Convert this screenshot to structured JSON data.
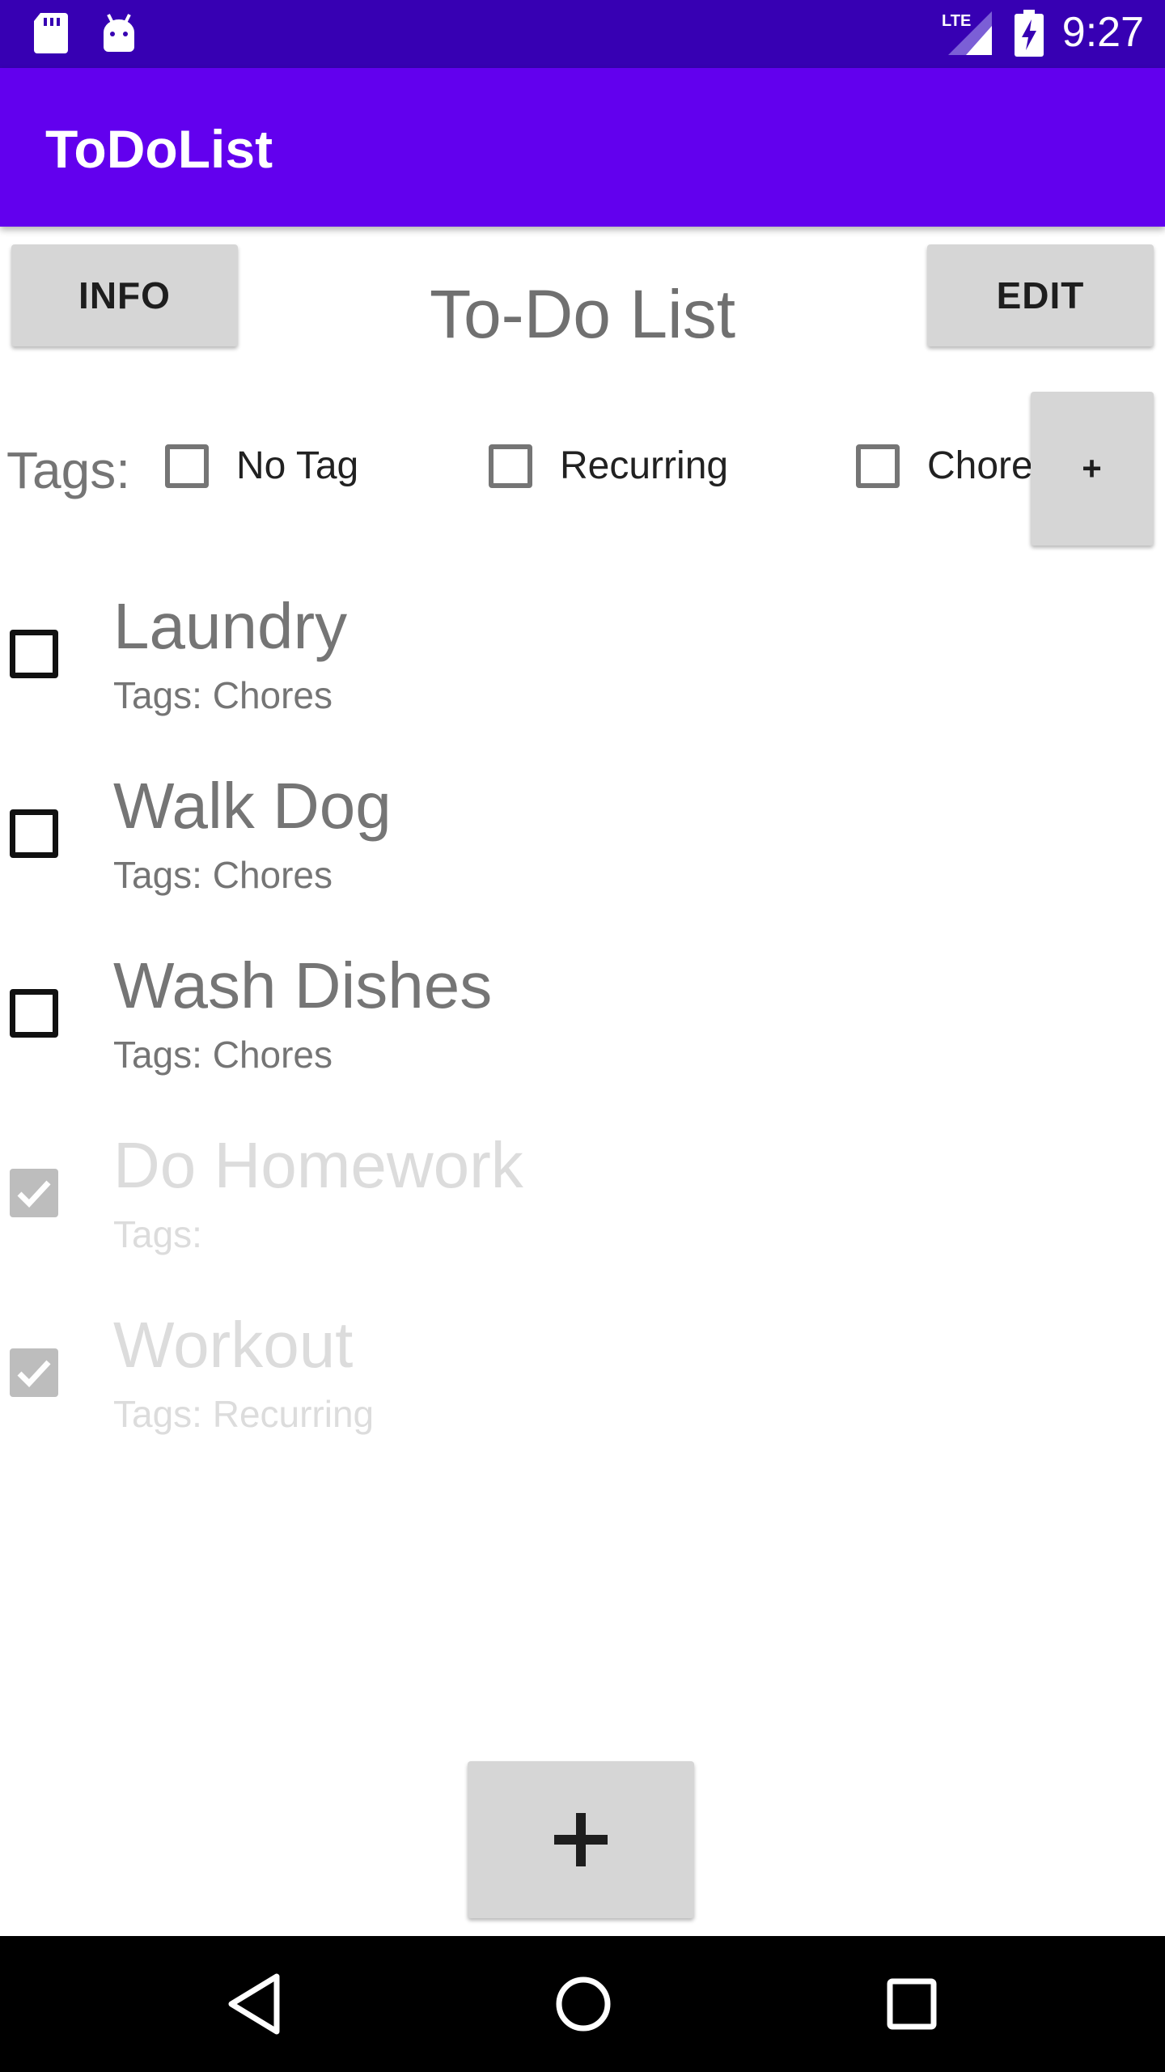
{
  "status_bar": {
    "time": "9:27",
    "network": "LTE",
    "icons": [
      "sd-card-icon",
      "android-debug-icon",
      "lte-signal-icon",
      "battery-charging-icon"
    ]
  },
  "app_bar": {
    "title": "ToDoList"
  },
  "toolbar": {
    "info_label": "INFO",
    "edit_label": "EDIT",
    "add_tag_label": "+"
  },
  "heading": "To-Do List",
  "tags": {
    "label": "Tags:",
    "items": [
      {
        "label": "No Tag",
        "checked": false
      },
      {
        "label": "Recurring",
        "checked": false
      },
      {
        "label": "Chores",
        "checked": false
      }
    ]
  },
  "tasks": [
    {
      "name": "Laundry",
      "tags": "Tags: Chores",
      "done": false
    },
    {
      "name": "Walk Dog",
      "tags": "Tags: Chores",
      "done": false
    },
    {
      "name": "Wash Dishes",
      "tags": "Tags: Chores",
      "done": false
    },
    {
      "name": "Do Homework",
      "tags": "Tags:",
      "done": true
    },
    {
      "name": "Workout",
      "tags": "Tags: Recurring",
      "done": true
    }
  ],
  "fab": {
    "label": "+"
  },
  "nav_bar": {
    "icons": [
      "back-icon",
      "home-icon",
      "recents-icon"
    ]
  },
  "colors": {
    "status_bar": "#3700b3",
    "app_bar": "#6200ee",
    "button": "#d6d6d6",
    "nav_bar": "#000000"
  }
}
